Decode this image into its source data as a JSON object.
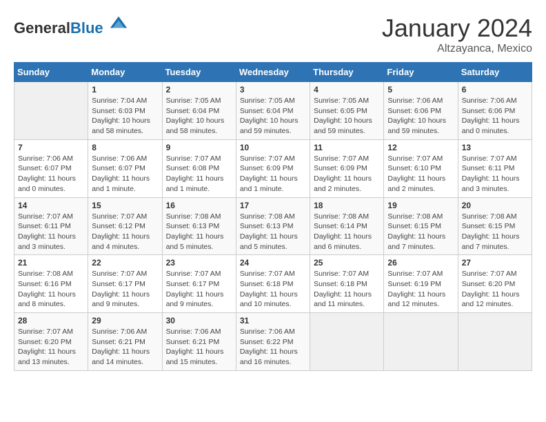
{
  "header": {
    "logo_general": "General",
    "logo_blue": "Blue",
    "month_title": "January 2024",
    "subtitle": "Altzayanca, Mexico"
  },
  "days_of_week": [
    "Sunday",
    "Monday",
    "Tuesday",
    "Wednesday",
    "Thursday",
    "Friday",
    "Saturday"
  ],
  "weeks": [
    [
      {
        "day": "",
        "info": ""
      },
      {
        "day": "1",
        "info": "Sunrise: 7:04 AM\nSunset: 6:03 PM\nDaylight: 10 hours\nand 58 minutes."
      },
      {
        "day": "2",
        "info": "Sunrise: 7:05 AM\nSunset: 6:04 PM\nDaylight: 10 hours\nand 58 minutes."
      },
      {
        "day": "3",
        "info": "Sunrise: 7:05 AM\nSunset: 6:04 PM\nDaylight: 10 hours\nand 59 minutes."
      },
      {
        "day": "4",
        "info": "Sunrise: 7:05 AM\nSunset: 6:05 PM\nDaylight: 10 hours\nand 59 minutes."
      },
      {
        "day": "5",
        "info": "Sunrise: 7:06 AM\nSunset: 6:06 PM\nDaylight: 10 hours\nand 59 minutes."
      },
      {
        "day": "6",
        "info": "Sunrise: 7:06 AM\nSunset: 6:06 PM\nDaylight: 11 hours\nand 0 minutes."
      }
    ],
    [
      {
        "day": "7",
        "info": "Sunrise: 7:06 AM\nSunset: 6:07 PM\nDaylight: 11 hours\nand 0 minutes."
      },
      {
        "day": "8",
        "info": "Sunrise: 7:06 AM\nSunset: 6:07 PM\nDaylight: 11 hours\nand 1 minute."
      },
      {
        "day": "9",
        "info": "Sunrise: 7:07 AM\nSunset: 6:08 PM\nDaylight: 11 hours\nand 1 minute."
      },
      {
        "day": "10",
        "info": "Sunrise: 7:07 AM\nSunset: 6:09 PM\nDaylight: 11 hours\nand 1 minute."
      },
      {
        "day": "11",
        "info": "Sunrise: 7:07 AM\nSunset: 6:09 PM\nDaylight: 11 hours\nand 2 minutes."
      },
      {
        "day": "12",
        "info": "Sunrise: 7:07 AM\nSunset: 6:10 PM\nDaylight: 11 hours\nand 2 minutes."
      },
      {
        "day": "13",
        "info": "Sunrise: 7:07 AM\nSunset: 6:11 PM\nDaylight: 11 hours\nand 3 minutes."
      }
    ],
    [
      {
        "day": "14",
        "info": "Sunrise: 7:07 AM\nSunset: 6:11 PM\nDaylight: 11 hours\nand 3 minutes."
      },
      {
        "day": "15",
        "info": "Sunrise: 7:07 AM\nSunset: 6:12 PM\nDaylight: 11 hours\nand 4 minutes."
      },
      {
        "day": "16",
        "info": "Sunrise: 7:08 AM\nSunset: 6:13 PM\nDaylight: 11 hours\nand 5 minutes."
      },
      {
        "day": "17",
        "info": "Sunrise: 7:08 AM\nSunset: 6:13 PM\nDaylight: 11 hours\nand 5 minutes."
      },
      {
        "day": "18",
        "info": "Sunrise: 7:08 AM\nSunset: 6:14 PM\nDaylight: 11 hours\nand 6 minutes."
      },
      {
        "day": "19",
        "info": "Sunrise: 7:08 AM\nSunset: 6:15 PM\nDaylight: 11 hours\nand 7 minutes."
      },
      {
        "day": "20",
        "info": "Sunrise: 7:08 AM\nSunset: 6:15 PM\nDaylight: 11 hours\nand 7 minutes."
      }
    ],
    [
      {
        "day": "21",
        "info": "Sunrise: 7:08 AM\nSunset: 6:16 PM\nDaylight: 11 hours\nand 8 minutes."
      },
      {
        "day": "22",
        "info": "Sunrise: 7:07 AM\nSunset: 6:17 PM\nDaylight: 11 hours\nand 9 minutes."
      },
      {
        "day": "23",
        "info": "Sunrise: 7:07 AM\nSunset: 6:17 PM\nDaylight: 11 hours\nand 9 minutes."
      },
      {
        "day": "24",
        "info": "Sunrise: 7:07 AM\nSunset: 6:18 PM\nDaylight: 11 hours\nand 10 minutes."
      },
      {
        "day": "25",
        "info": "Sunrise: 7:07 AM\nSunset: 6:18 PM\nDaylight: 11 hours\nand 11 minutes."
      },
      {
        "day": "26",
        "info": "Sunrise: 7:07 AM\nSunset: 6:19 PM\nDaylight: 11 hours\nand 12 minutes."
      },
      {
        "day": "27",
        "info": "Sunrise: 7:07 AM\nSunset: 6:20 PM\nDaylight: 11 hours\nand 12 minutes."
      }
    ],
    [
      {
        "day": "28",
        "info": "Sunrise: 7:07 AM\nSunset: 6:20 PM\nDaylight: 11 hours\nand 13 minutes."
      },
      {
        "day": "29",
        "info": "Sunrise: 7:06 AM\nSunset: 6:21 PM\nDaylight: 11 hours\nand 14 minutes."
      },
      {
        "day": "30",
        "info": "Sunrise: 7:06 AM\nSunset: 6:21 PM\nDaylight: 11 hours\nand 15 minutes."
      },
      {
        "day": "31",
        "info": "Sunrise: 7:06 AM\nSunset: 6:22 PM\nDaylight: 11 hours\nand 16 minutes."
      },
      {
        "day": "",
        "info": ""
      },
      {
        "day": "",
        "info": ""
      },
      {
        "day": "",
        "info": ""
      }
    ]
  ]
}
